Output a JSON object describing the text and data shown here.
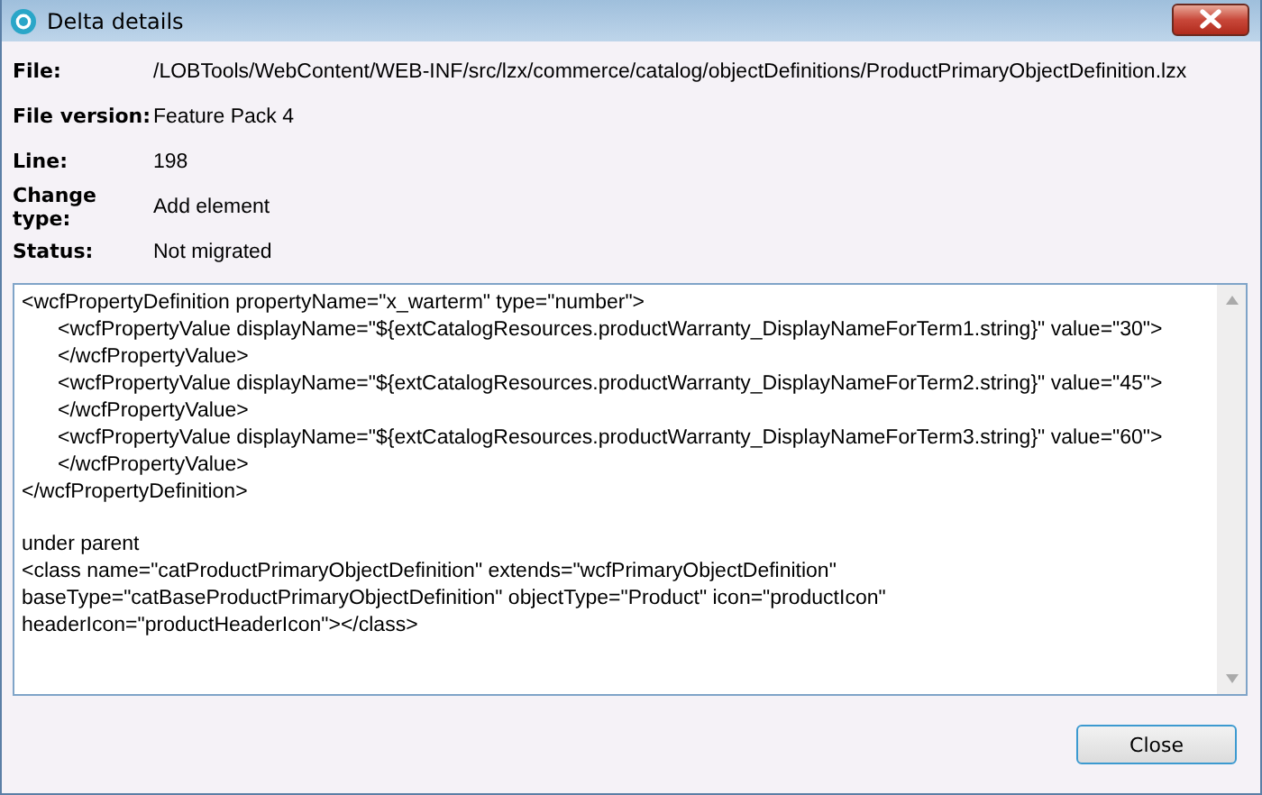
{
  "window": {
    "title": "Delta details"
  },
  "fields": [
    {
      "label": "File:",
      "value": "/LOBTools/WebContent/WEB-INF/src/lzx/commerce/catalog/objectDefinitions/ProductPrimaryObjectDefinition.lzx"
    },
    {
      "label": "File version:",
      "value": "Feature Pack 4"
    },
    {
      "label": "Line:",
      "value": "198"
    },
    {
      "label": "Change type:",
      "value": "Add element"
    },
    {
      "label": "Status:",
      "value": "Not migrated"
    }
  ],
  "code": {
    "paragraphs": [
      {
        "lines": [
          {
            "text": "<wcfPropertyDefinition propertyName=\"x_warterm\" type=\"number\">",
            "children": [
              {
                "text": "<wcfPropertyValue displayName=\"${extCatalogResources.productWarranty_DisplayNameForTerm1.string}\" value=\"30\">"
              },
              {
                "text": "</wcfPropertyValue>"
              },
              {
                "text": "<wcfPropertyValue displayName=\"${extCatalogResources.productWarranty_DisplayNameForTerm2.string}\" value=\"45\">"
              },
              {
                "text": "</wcfPropertyValue>"
              },
              {
                "text": "<wcfPropertyValue displayName=\"${extCatalogResources.productWarranty_DisplayNameForTerm3.string}\" value=\"60\">"
              },
              {
                "text": "</wcfPropertyValue>"
              }
            ]
          },
          {
            "text": "</wcfPropertyDefinition>"
          }
        ]
      },
      {
        "lines": [
          {
            "text": "under parent"
          },
          {
            "text": "<class name=\"catProductPrimaryObjectDefinition\" extends=\"wcfPrimaryObjectDefinition\""
          },
          {
            "text": "baseType=\"catBaseProductPrimaryObjectDefinition\" objectType=\"Product\" icon=\"productIcon\""
          },
          {
            "text": "headerIcon=\"productHeaderIcon\"></class>"
          }
        ]
      }
    ]
  },
  "buttons": [
    {
      "label": "Close"
    }
  ]
}
